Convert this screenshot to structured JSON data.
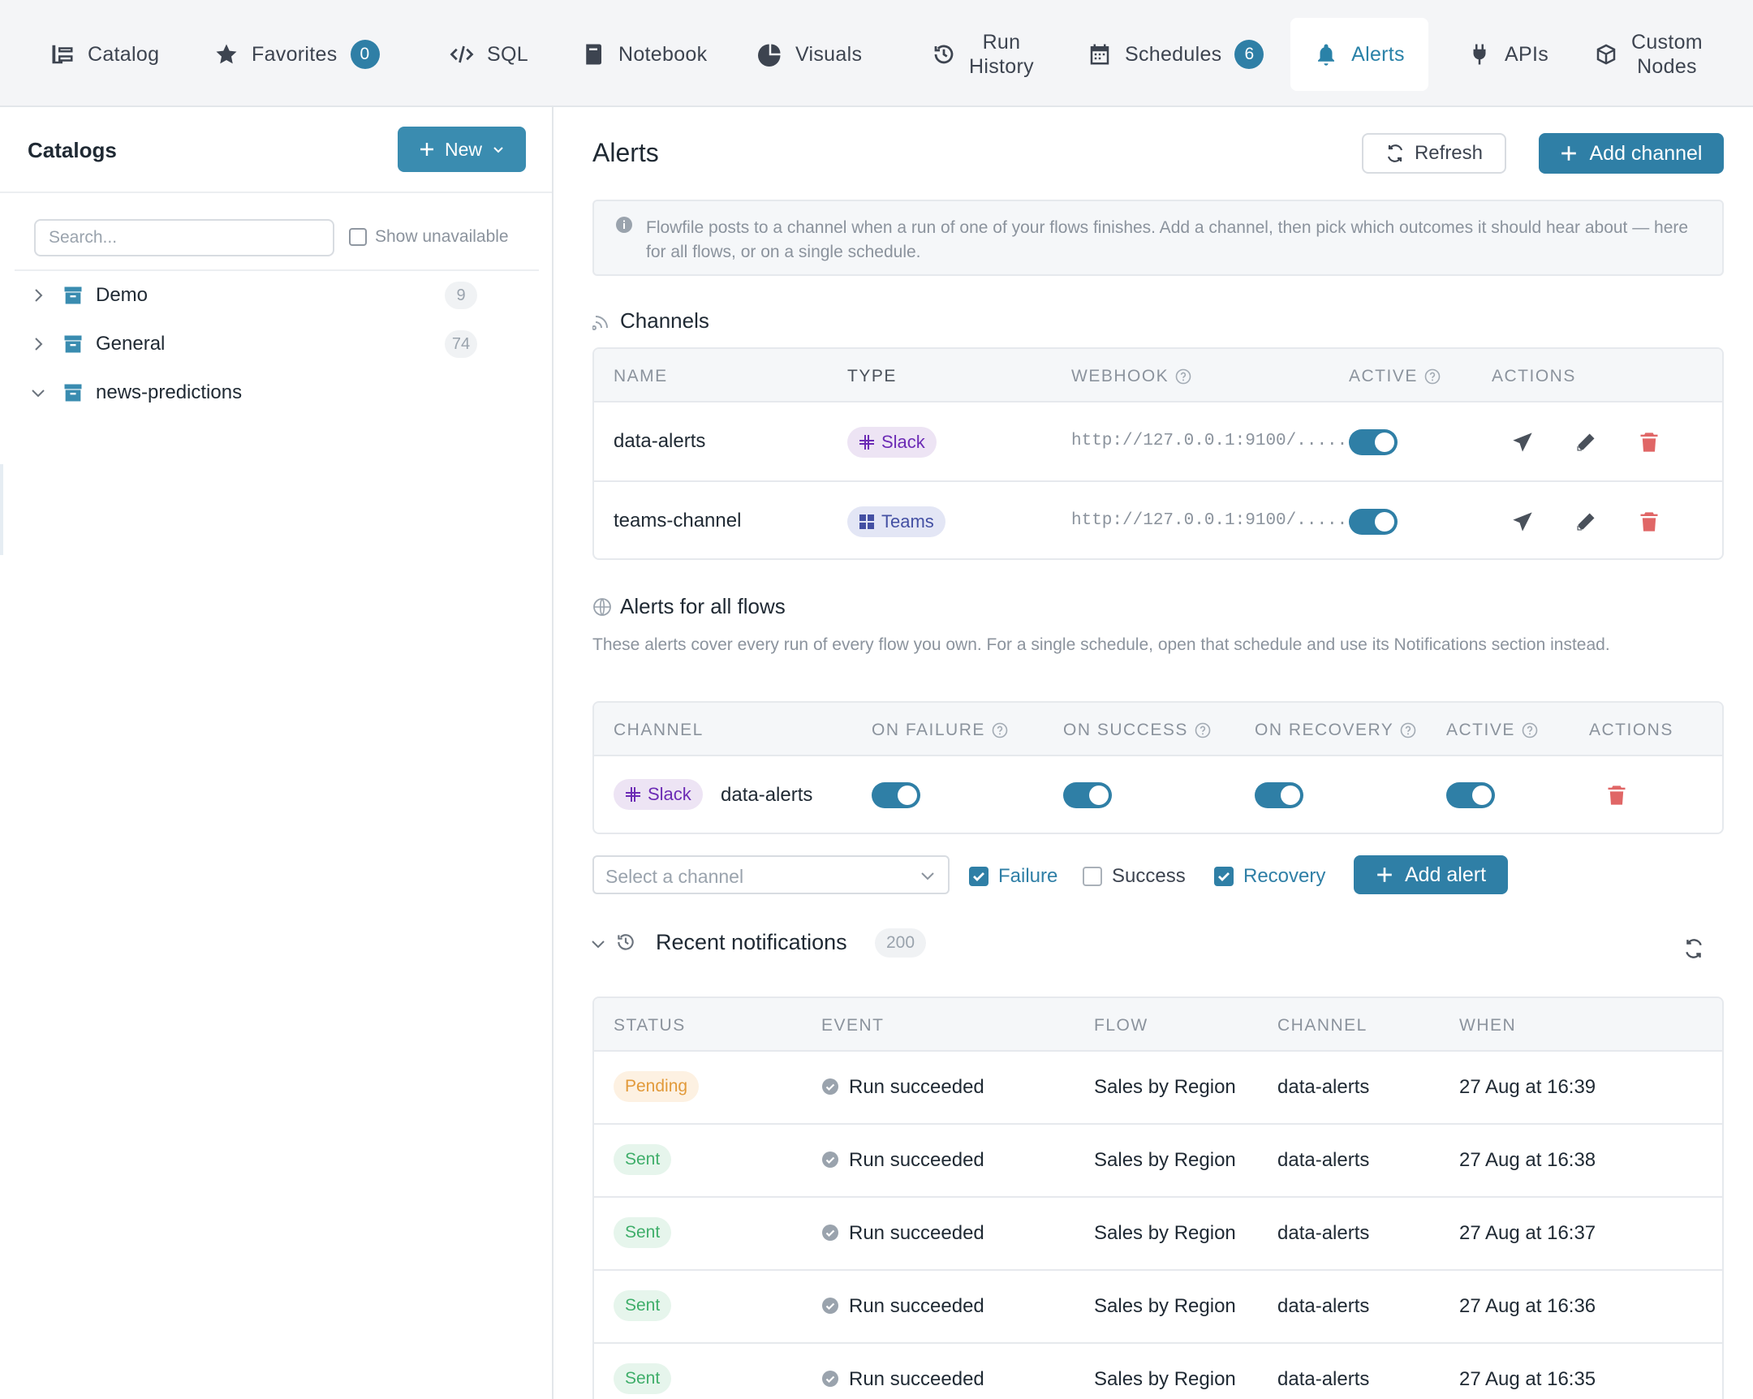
{
  "nav": {
    "items": [
      {
        "label": "Catalog",
        "icon": "catalog-icon"
      },
      {
        "label": "Favorites",
        "icon": "star-icon",
        "badge": "0"
      },
      {
        "label": "SQL",
        "icon": "code-icon"
      },
      {
        "label": "Notebook",
        "icon": "notebook-icon"
      },
      {
        "label": "Visuals",
        "icon": "pie-chart-icon"
      },
      {
        "label": "Run",
        "label2": "History",
        "icon": "history-icon"
      },
      {
        "label": "Schedules",
        "icon": "calendar-icon",
        "badge": "6"
      },
      {
        "label": "Alerts",
        "icon": "bell-icon",
        "active": true
      },
      {
        "label": "APIs",
        "icon": "plug-icon"
      },
      {
        "label": "Custom",
        "label2": "Nodes",
        "icon": "cube-icon"
      }
    ]
  },
  "sidebar": {
    "title": "Catalogs",
    "new_label": "New",
    "search_placeholder": "Search...",
    "show_unavailable": "Show unavailable",
    "catalogs": [
      {
        "name": "Demo",
        "count": "9",
        "expanded": false
      },
      {
        "name": "General",
        "count": "74",
        "expanded": false
      },
      {
        "name": "news-predictions",
        "count": "",
        "expanded": true
      }
    ]
  },
  "main": {
    "title": "Alerts",
    "refresh_label": "Refresh",
    "add_channel_label": "Add channel",
    "info_text": "Flowfile posts to a channel when a run of one of your flows finishes. Add a channel, then pick which outcomes it should hear about — here for all flows, or on a single schedule.",
    "channels": {
      "heading": "Channels",
      "columns": [
        "NAME",
        "TYPE",
        "WEBHOOK",
        "ACTIVE",
        "ACTIONS"
      ],
      "rows": [
        {
          "name": "data-alerts",
          "type": "Slack",
          "webhook": "http://127.0.0.1:9100/.....",
          "active": true
        },
        {
          "name": "teams-channel",
          "type": "Teams",
          "webhook": "http://127.0.0.1:9100/.....",
          "active": true
        }
      ]
    },
    "all_flows": {
      "heading": "Alerts for all flows",
      "description": "These alerts cover every run of every flow you own. For a single schedule, open that schedule and use its Notifications section instead.",
      "columns": [
        "CHANNEL",
        "ON FAILURE",
        "ON SUCCESS",
        "ON RECOVERY",
        "ACTIVE",
        "ACTIONS"
      ],
      "rows": [
        {
          "type": "Slack",
          "channel": "data-alerts",
          "on_failure": true,
          "on_success": true,
          "on_recovery": true,
          "active": true
        }
      ],
      "select_placeholder": "Select a channel",
      "failure_label": "Failure",
      "success_label": "Success",
      "recovery_label": "Recovery",
      "failure_checked": true,
      "success_checked": false,
      "recovery_checked": true,
      "add_alert_label": "Add alert"
    },
    "recent": {
      "heading": "Recent notifications",
      "count": "200",
      "columns": [
        "STATUS",
        "EVENT",
        "FLOW",
        "CHANNEL",
        "WHEN"
      ],
      "rows": [
        {
          "status": "Pending",
          "event": "Run succeeded",
          "flow": "Sales by Region",
          "channel": "data-alerts",
          "when": "27 Aug at 16:39"
        },
        {
          "status": "Sent",
          "event": "Run succeeded",
          "flow": "Sales by Region",
          "channel": "data-alerts",
          "when": "27 Aug at 16:38"
        },
        {
          "status": "Sent",
          "event": "Run succeeded",
          "flow": "Sales by Region",
          "channel": "data-alerts",
          "when": "27 Aug at 16:37"
        },
        {
          "status": "Sent",
          "event": "Run succeeded",
          "flow": "Sales by Region",
          "channel": "data-alerts",
          "when": "27 Aug at 16:36"
        },
        {
          "status": "Sent",
          "event": "Run succeeded",
          "flow": "Sales by Region",
          "channel": "data-alerts",
          "when": "27 Aug at 16:35"
        }
      ]
    }
  },
  "colors": {
    "accent": "#2f7fa6",
    "danger": "#e06666",
    "slack": "#6c2bb5",
    "teams": "#4450a3",
    "sent": "#3fae6a",
    "pending": "#e29a3a"
  }
}
